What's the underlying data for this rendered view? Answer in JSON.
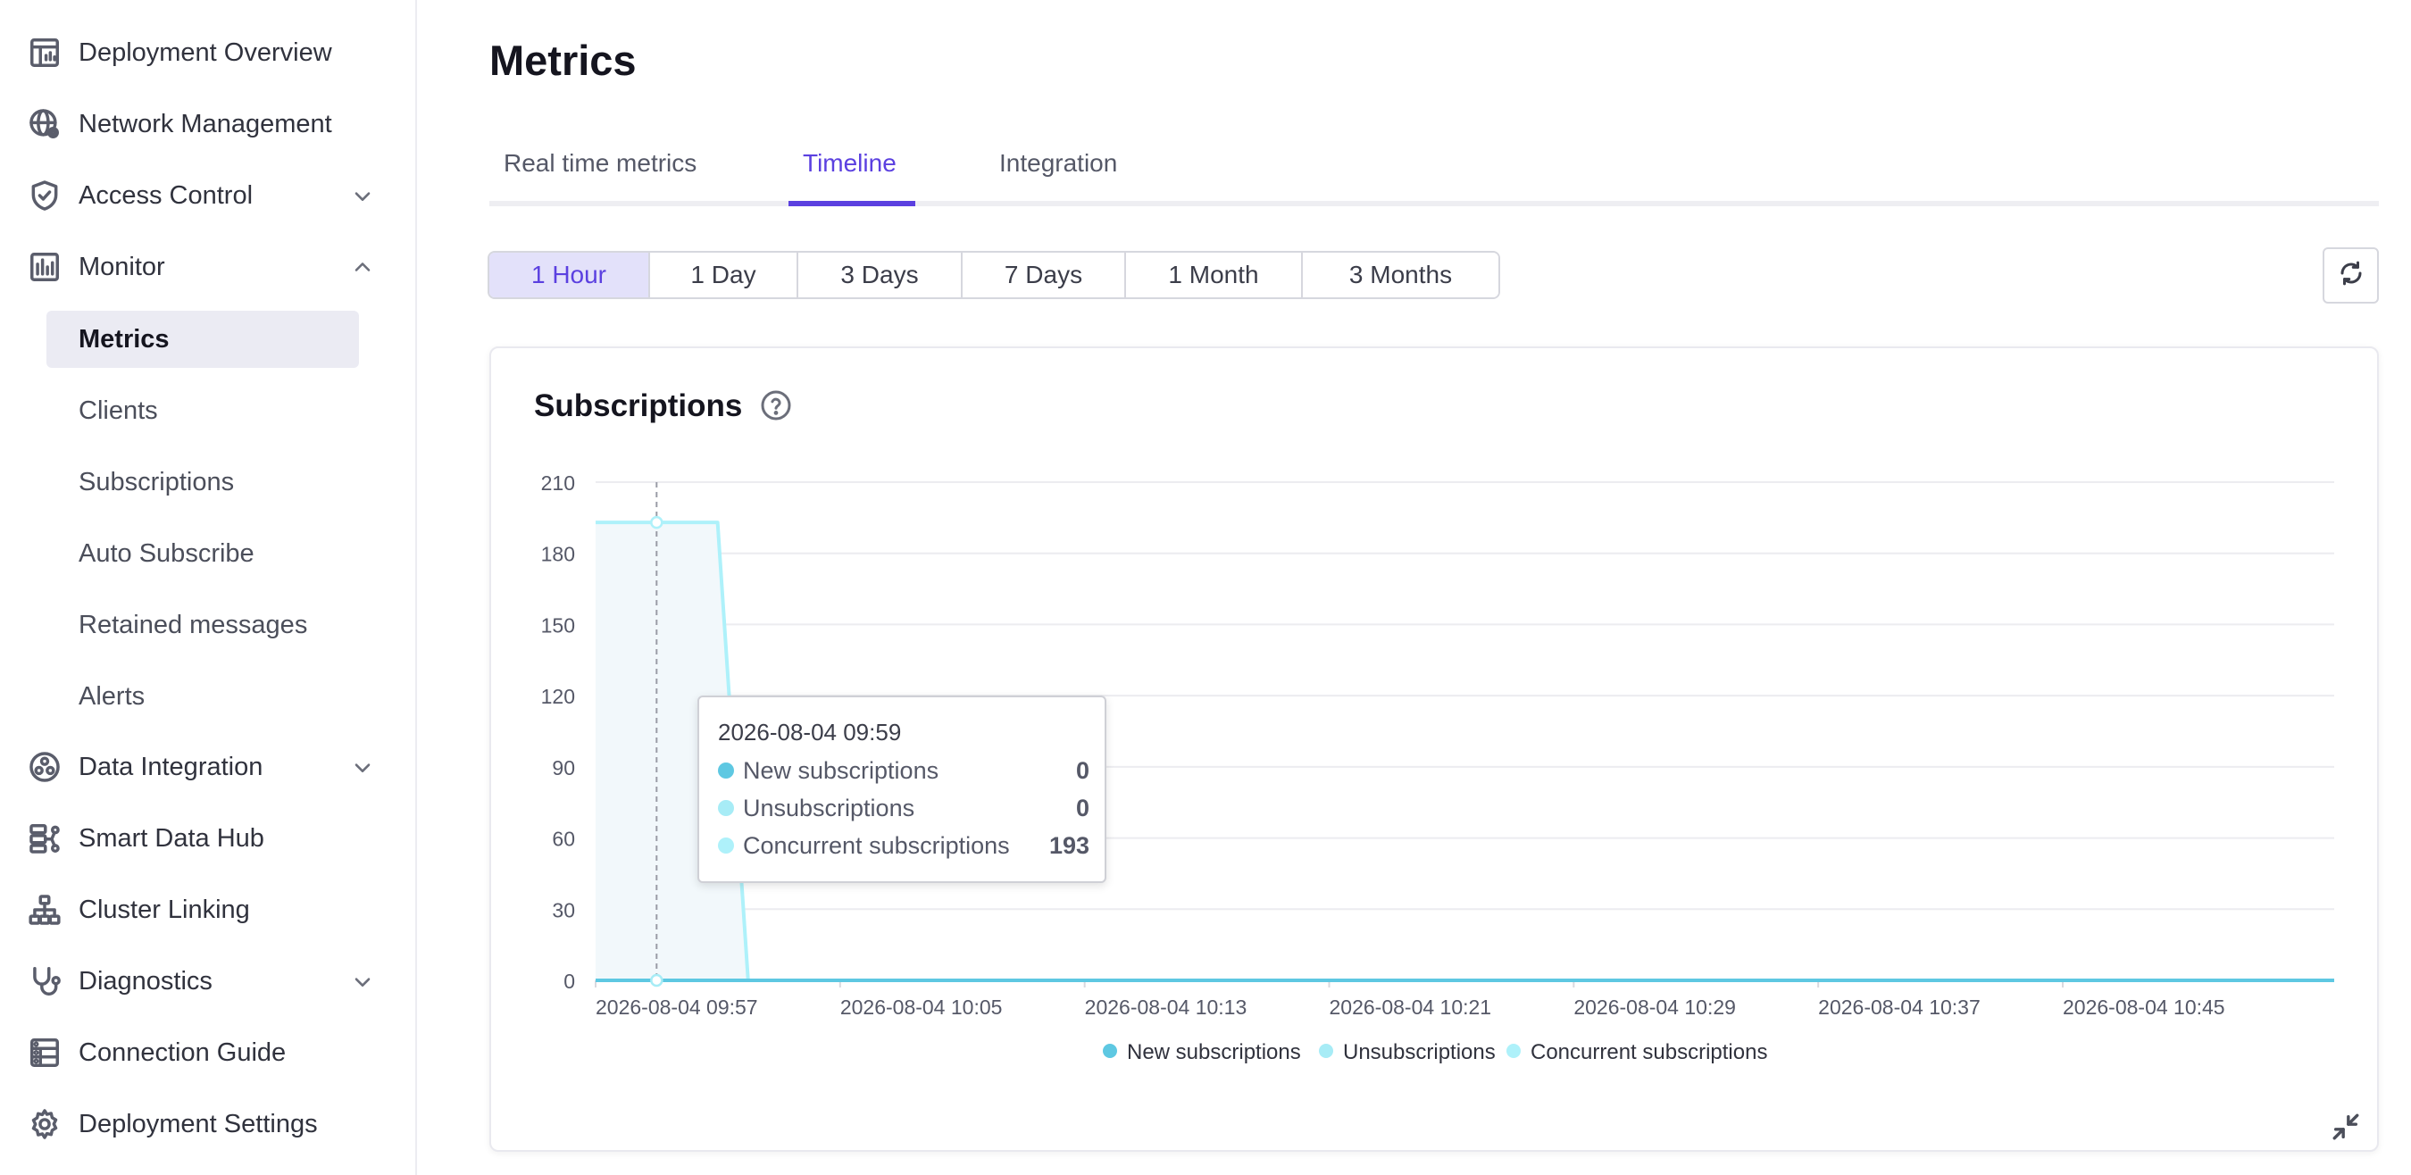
{
  "sidebar": {
    "items": [
      {
        "label": "Deployment Overview",
        "icon": "dashboard-icon"
      },
      {
        "label": "Network Management",
        "icon": "globe-gear-icon"
      },
      {
        "label": "Access Control",
        "icon": "shield-check-icon",
        "expandable": true
      },
      {
        "label": "Monitor",
        "icon": "bar-chart-icon",
        "expanded": true
      },
      {
        "label": "Data Integration",
        "icon": "integration-icon",
        "expandable": true
      },
      {
        "label": "Smart Data Hub",
        "icon": "data-hub-icon"
      },
      {
        "label": "Cluster Linking",
        "icon": "cluster-icon"
      },
      {
        "label": "Diagnostics",
        "icon": "stethoscope-icon",
        "expandable": true
      },
      {
        "label": "Connection Guide",
        "icon": "connection-icon"
      },
      {
        "label": "Deployment Settings",
        "icon": "gear-icon"
      }
    ],
    "monitor_sub": [
      {
        "label": "Metrics",
        "active": true
      },
      {
        "label": "Clients"
      },
      {
        "label": "Subscriptions"
      },
      {
        "label": "Auto Subscribe"
      },
      {
        "label": "Retained messages"
      },
      {
        "label": "Alerts"
      }
    ]
  },
  "main": {
    "title": "Metrics",
    "tabs": [
      {
        "label": "Real time metrics"
      },
      {
        "label": "Timeline",
        "active": true
      },
      {
        "label": "Integration"
      }
    ],
    "time_ranges": [
      "1 Hour",
      "1 Day",
      "3 Days",
      "7 Days",
      "1 Month",
      "3 Months"
    ],
    "selected_range": "1 Hour",
    "accent_color": "#5b40e0"
  },
  "card": {
    "title": "Subscriptions"
  },
  "tooltip": {
    "time": "2026-08-04 09:59",
    "rows": [
      {
        "name": "New subscriptions",
        "value": "0"
      },
      {
        "name": "Unsubscriptions",
        "value": "0"
      },
      {
        "name": "Concurrent subscriptions",
        "value": "193"
      }
    ]
  },
  "chart_data": {
    "type": "area",
    "title": "Subscriptions",
    "x_ticks": [
      "2026-08-04 09:57",
      "2026-08-04 10:05",
      "2026-08-04 10:13",
      "2026-08-04 10:21",
      "2026-08-04 10:29",
      "2026-08-04 10:37",
      "2026-08-04 10:45"
    ],
    "y_ticks": [
      0,
      30,
      60,
      90,
      120,
      150,
      180,
      210
    ],
    "ylim": [
      0,
      210
    ],
    "x_minutes_range": [
      0,
      57
    ],
    "grid": true,
    "legend_position": "bottom",
    "series": [
      {
        "name": "New subscriptions",
        "color": "#5ec8e2",
        "points": [
          [
            0,
            0
          ],
          [
            57,
            0
          ]
        ]
      },
      {
        "name": "Unsubscriptions",
        "color": "#a7ecf6",
        "points": [
          [
            0,
            0
          ],
          [
            57,
            0
          ]
        ]
      },
      {
        "name": "Concurrent subscriptions",
        "color": "#aef1fa",
        "points": [
          [
            0,
            193
          ],
          [
            4,
            193
          ],
          [
            5,
            0
          ],
          [
            57,
            0
          ]
        ]
      }
    ],
    "hover_x_minutes": 2
  }
}
